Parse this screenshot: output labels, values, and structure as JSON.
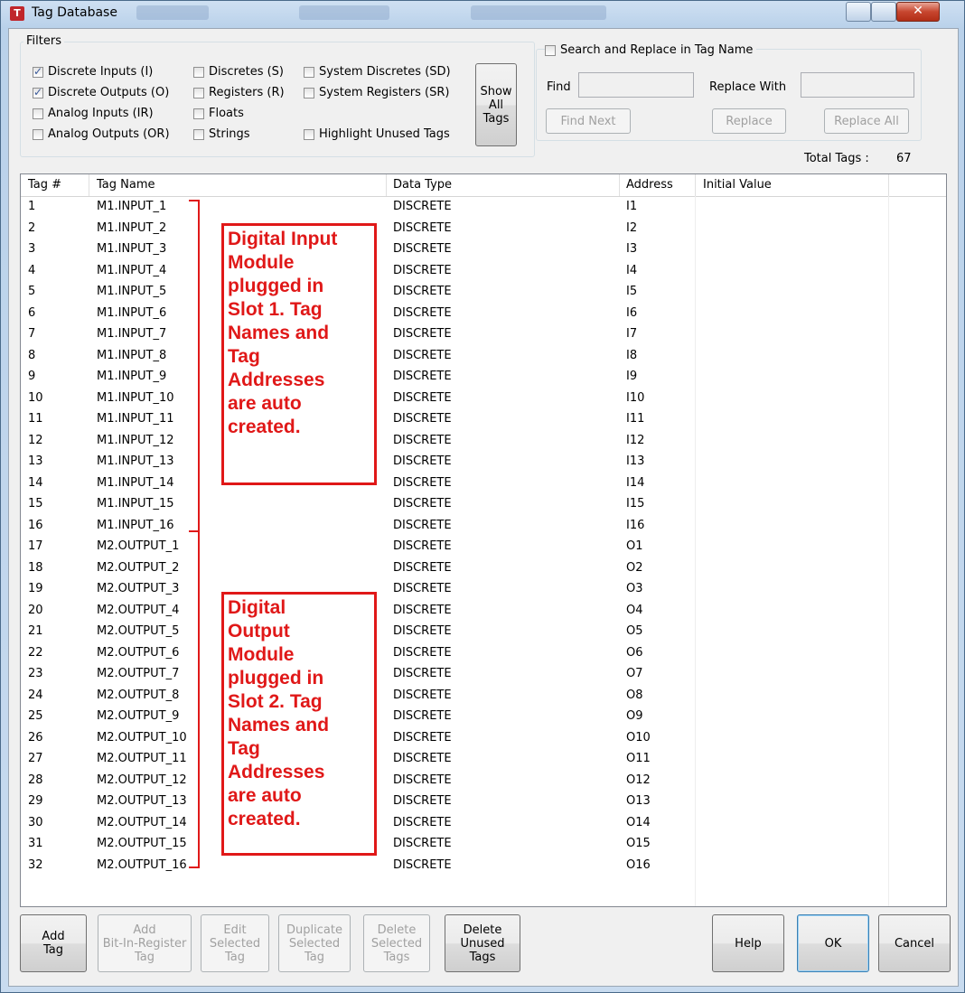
{
  "window": {
    "title": "Tag Database",
    "close_glyph": "✕"
  },
  "filters": {
    "legend": "Filters",
    "checks": [
      {
        "label": "Discrete Inputs (I)",
        "checked": true
      },
      {
        "label": "Discrete Outputs (O)",
        "checked": true
      },
      {
        "label": "Analog Inputs (IR)",
        "checked": false
      },
      {
        "label": "Analog Outputs (OR)",
        "checked": false
      },
      {
        "label": "Discretes (S)",
        "checked": false
      },
      {
        "label": "Registers (R)",
        "checked": false
      },
      {
        "label": "Floats",
        "checked": false
      },
      {
        "label": "Strings",
        "checked": false
      },
      {
        "label": "System Discretes (SD)",
        "checked": false
      },
      {
        "label": "System Registers (SR)",
        "checked": false
      },
      {
        "label": "Highlight Unused Tags",
        "checked": false
      }
    ],
    "show_all": "Show\nAll\nTags"
  },
  "search": {
    "legend": "Search and Replace in Tag Name",
    "find_label": "Find",
    "replace_label": "Replace With",
    "find_next": "Find Next",
    "replace": "Replace",
    "replace_all": "Replace All",
    "find_value": "",
    "replace_value": ""
  },
  "total": {
    "label": "Total Tags :",
    "value": "67"
  },
  "table": {
    "headers": [
      "Tag #",
      "Tag Name",
      "Data Type",
      "Address",
      "Initial Value"
    ],
    "rows": [
      [
        "1",
        "M1.INPUT_1",
        "DISCRETE",
        "I1",
        ""
      ],
      [
        "2",
        "M1.INPUT_2",
        "DISCRETE",
        "I2",
        ""
      ],
      [
        "3",
        "M1.INPUT_3",
        "DISCRETE",
        "I3",
        ""
      ],
      [
        "4",
        "M1.INPUT_4",
        "DISCRETE",
        "I4",
        ""
      ],
      [
        "5",
        "M1.INPUT_5",
        "DISCRETE",
        "I5",
        ""
      ],
      [
        "6",
        "M1.INPUT_6",
        "DISCRETE",
        "I6",
        ""
      ],
      [
        "7",
        "M1.INPUT_7",
        "DISCRETE",
        "I7",
        ""
      ],
      [
        "8",
        "M1.INPUT_8",
        "DISCRETE",
        "I8",
        ""
      ],
      [
        "9",
        "M1.INPUT_9",
        "DISCRETE",
        "I9",
        ""
      ],
      [
        "10",
        "M1.INPUT_10",
        "DISCRETE",
        "I10",
        ""
      ],
      [
        "11",
        "M1.INPUT_11",
        "DISCRETE",
        "I11",
        ""
      ],
      [
        "12",
        "M1.INPUT_12",
        "DISCRETE",
        "I12",
        ""
      ],
      [
        "13",
        "M1.INPUT_13",
        "DISCRETE",
        "I13",
        ""
      ],
      [
        "14",
        "M1.INPUT_14",
        "DISCRETE",
        "I14",
        ""
      ],
      [
        "15",
        "M1.INPUT_15",
        "DISCRETE",
        "I15",
        ""
      ],
      [
        "16",
        "M1.INPUT_16",
        "DISCRETE",
        "I16",
        ""
      ],
      [
        "17",
        "M2.OUTPUT_1",
        "DISCRETE",
        "O1",
        ""
      ],
      [
        "18",
        "M2.OUTPUT_2",
        "DISCRETE",
        "O2",
        ""
      ],
      [
        "19",
        "M2.OUTPUT_3",
        "DISCRETE",
        "O3",
        ""
      ],
      [
        "20",
        "M2.OUTPUT_4",
        "DISCRETE",
        "O4",
        ""
      ],
      [
        "21",
        "M2.OUTPUT_5",
        "DISCRETE",
        "O5",
        ""
      ],
      [
        "22",
        "M2.OUTPUT_6",
        "DISCRETE",
        "O6",
        ""
      ],
      [
        "23",
        "M2.OUTPUT_7",
        "DISCRETE",
        "O7",
        ""
      ],
      [
        "24",
        "M2.OUTPUT_8",
        "DISCRETE",
        "O8",
        ""
      ],
      [
        "25",
        "M2.OUTPUT_9",
        "DISCRETE",
        "O9",
        ""
      ],
      [
        "26",
        "M2.OUTPUT_10",
        "DISCRETE",
        "O10",
        ""
      ],
      [
        "27",
        "M2.OUTPUT_11",
        "DISCRETE",
        "O11",
        ""
      ],
      [
        "28",
        "M2.OUTPUT_12",
        "DISCRETE",
        "O12",
        ""
      ],
      [
        "29",
        "M2.OUTPUT_13",
        "DISCRETE",
        "O13",
        ""
      ],
      [
        "30",
        "M2.OUTPUT_14",
        "DISCRETE",
        "O14",
        ""
      ],
      [
        "31",
        "M2.OUTPUT_15",
        "DISCRETE",
        "O15",
        ""
      ],
      [
        "32",
        "M2.OUTPUT_16",
        "DISCRETE",
        "O16",
        ""
      ]
    ]
  },
  "annotations": [
    {
      "text": "Digital Input Module plugged in Slot 1. Tag Names and Tag Addresses are auto created.",
      "lines": [
        "Digital Input",
        "Module",
        "plugged in",
        "Slot 1. Tag",
        "Names and",
        "Tag",
        "Addresses",
        "are auto",
        "created."
      ]
    },
    {
      "text": "Digital Output Module plugged in Slot 2. Tag Names and Tag Addresses are auto created.",
      "lines": [
        "Digital",
        "Output",
        "Module",
        "plugged in",
        "Slot 2. Tag",
        "Names and",
        "Tag",
        "Addresses",
        "are auto",
        "created."
      ]
    }
  ],
  "buttons": {
    "add_tag": "Add\nTag",
    "add_bit": "Add\nBit-In-Register\nTag",
    "edit": "Edit\nSelected\nTag",
    "duplicate": "Duplicate\nSelected\nTag",
    "delete_sel": "Delete\nSelected\nTags",
    "delete_unused": "Delete\nUnused\nTags",
    "help": "Help",
    "ok": "OK",
    "cancel": "Cancel"
  }
}
